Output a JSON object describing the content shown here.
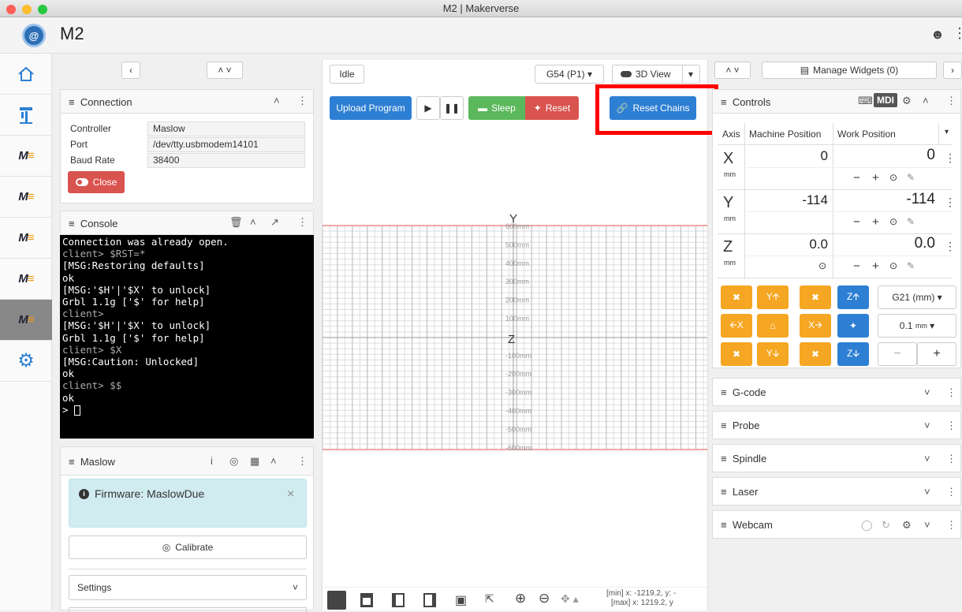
{
  "window": {
    "title": "M2 | Makerverse"
  },
  "header": {
    "app_name": "M2"
  },
  "connection": {
    "title": "Connection",
    "fields": [
      {
        "label": "Controller",
        "value": "Maslow"
      },
      {
        "label": "Port",
        "value": "/dev/tty.usbmodem14101"
      },
      {
        "label": "Baud Rate",
        "value": "38400"
      }
    ],
    "close_label": "Close"
  },
  "console": {
    "title": "Console",
    "lines": [
      {
        "text": "Connection was already open.",
        "kind": "out"
      },
      {
        "text": "client> $RST=*",
        "kind": "client"
      },
      {
        "text": "[MSG:Restoring defaults]",
        "kind": "out"
      },
      {
        "text": "ok",
        "kind": "out"
      },
      {
        "text": "[MSG:'$H'|'$X' to unlock]",
        "kind": "out"
      },
      {
        "text": "Grbl 1.1g ['$' for help]",
        "kind": "out"
      },
      {
        "text": "client>",
        "kind": "client"
      },
      {
        "text": "[MSG:'$H'|'$X' to unlock]",
        "kind": "out"
      },
      {
        "text": "Grbl 1.1g ['$' for help]",
        "kind": "out"
      },
      {
        "text": "client> $X",
        "kind": "client"
      },
      {
        "text": "[MSG:Caution: Unlocked]",
        "kind": "out"
      },
      {
        "text": "ok",
        "kind": "out"
      },
      {
        "text": "client> $$",
        "kind": "client"
      },
      {
        "text": "ok",
        "kind": "out"
      }
    ],
    "prompt": ">"
  },
  "maslow": {
    "title": "Maslow",
    "firmware_alert": "Firmware: MaslowDue",
    "calibrate_label": "Calibrate",
    "settings_label": "Settings"
  },
  "visualizer": {
    "state": "Idle",
    "wcs": "G54 (P1)",
    "view_mode": "3D View",
    "upload_label": "Upload Program",
    "sleep_label": "Sleep",
    "reset_label": "Reset",
    "reset_chains_label": "Reset Chains",
    "axis_y": "Y",
    "axis_z": "Z",
    "y_ticks": [
      "600mm",
      "500mm",
      "400mm",
      "300mm",
      "200mm",
      "100mm",
      "",
      "-100mm",
      "-200mm",
      "-300mm",
      "-400mm",
      "-500mm",
      "-600mm"
    ],
    "bounds_min": "[min] x: -1219.2, y: -",
    "bounds_max": "[max] x: 1219.2, y"
  },
  "widgets_bar": {
    "manage_label": "Manage Widgets (0)"
  },
  "controls": {
    "title": "Controls",
    "mdi_label": "MDI",
    "col_axis": "Axis",
    "col_machine": "Machine Position",
    "col_work": "Work Position",
    "axes": [
      {
        "name": "X",
        "unit": "mm",
        "machine": "0",
        "work": "0"
      },
      {
        "name": "Y",
        "unit": "mm",
        "machine": "-114",
        "work": "-114"
      },
      {
        "name": "Z",
        "unit": "mm",
        "machine": "0.0",
        "work": "0.0"
      }
    ],
    "jog": {
      "y_plus": "Y🡩",
      "x_minus": "🡨X",
      "x_plus": "X🡪",
      "y_minus": "Y🡫",
      "z_plus": "Z🡩",
      "z_minus": "Z🡫"
    },
    "units_select": "G21 (mm)",
    "step_value": "0.1",
    "step_unit": "mm",
    "minus_label": "−",
    "plus_label": "+"
  },
  "widgets": [
    "G-code",
    "Probe",
    "Spindle",
    "Laser",
    "Webcam"
  ],
  "colors": {
    "primary": "#2d7fd3",
    "danger": "#d9534f",
    "success": "#5cb85c",
    "jog": "#f5a623",
    "highlight": "#ff0000"
  }
}
